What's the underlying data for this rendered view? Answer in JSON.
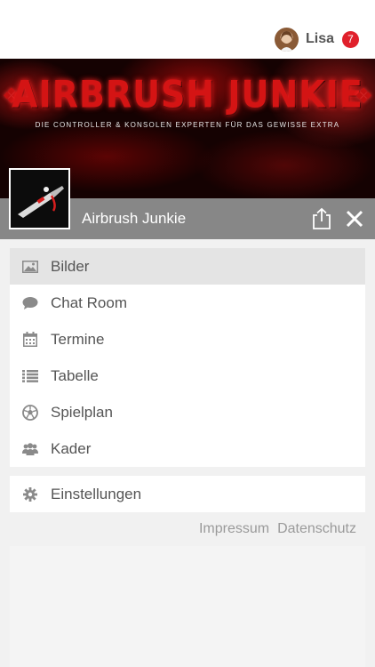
{
  "header": {
    "user_name": "Lisa",
    "notification_count": "7",
    "avatar_icon": "user-avatar"
  },
  "banner": {
    "title": "AIRBRUSH JUNKIE",
    "subtitle": "DIE CONTROLLER & KONSOLEN EXPERTEN FÜR DAS GEWISSE EXTRA",
    "deco_left": "❖",
    "deco_right": "❖"
  },
  "group": {
    "name": "Airbrush Junkie",
    "share_icon": "share-icon",
    "close_icon": "close-icon"
  },
  "menu": {
    "items": [
      {
        "label": "Bilder",
        "icon": "image-icon",
        "active": true
      },
      {
        "label": "Chat Room",
        "icon": "chat-bubble-icon",
        "active": false
      },
      {
        "label": "Termine",
        "icon": "calendar-icon",
        "active": false
      },
      {
        "label": "Tabelle",
        "icon": "list-icon",
        "active": false
      },
      {
        "label": "Spielplan",
        "icon": "soccer-ball-icon",
        "active": false
      },
      {
        "label": "Kader",
        "icon": "group-icon",
        "active": false
      }
    ]
  },
  "settings": {
    "label": "Einstellungen",
    "icon": "gear-icon"
  },
  "footer": {
    "impressum": "Impressum",
    "datenschutz": "Datenschutz"
  },
  "colors": {
    "accent_badge": "#e0202b",
    "title_bar": "#878787",
    "banner_red": "#d41414"
  }
}
